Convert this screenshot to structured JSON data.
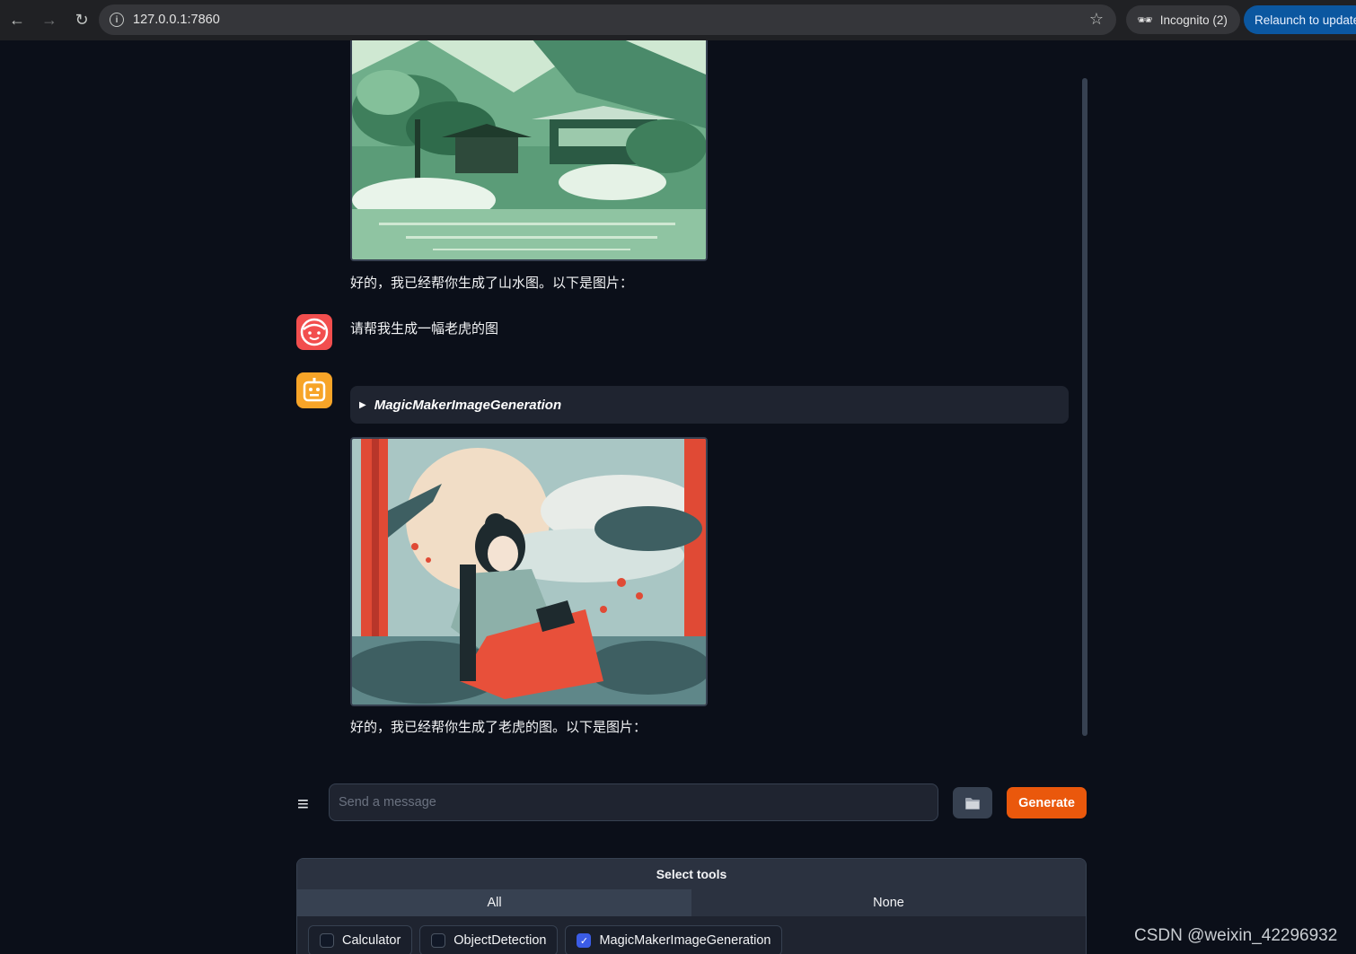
{
  "browser": {
    "url": "127.0.0.1:7860",
    "incognito_label": "Incognito (2)",
    "relaunch_label": "Relaunch to update"
  },
  "chat": {
    "messages": [
      {
        "role": "bot",
        "text": "好的，我已经帮你生成了山水图。以下是图片：",
        "image": "landscape-pavilion-image"
      },
      {
        "role": "user",
        "text": "请帮我生成一幅老虎的图"
      },
      {
        "role": "bot",
        "tool_call": "MagicMakerImageGeneration",
        "image": "woman-reading-image",
        "text": "好的，我已经帮你生成了老虎的图。以下是图片："
      }
    ]
  },
  "input": {
    "placeholder": "Send a message",
    "upload_icon": "folder-icon",
    "generate_label": "Generate"
  },
  "tools": {
    "title": "Select tools",
    "all_label": "All",
    "none_label": "None",
    "options": [
      {
        "label": "Calculator",
        "checked": false
      },
      {
        "label": "ObjectDetection",
        "checked": false
      },
      {
        "label": "MagicMakerImageGeneration",
        "checked": true
      }
    ]
  },
  "watermark": "CSDN @weixin_42296932",
  "colors": {
    "background": "#0b0f19",
    "generate": "#ea580c",
    "user_avatar": "#f24e4e",
    "bot_avatar": "#f7a428",
    "checkbox_checked": "#3b5ce6"
  }
}
